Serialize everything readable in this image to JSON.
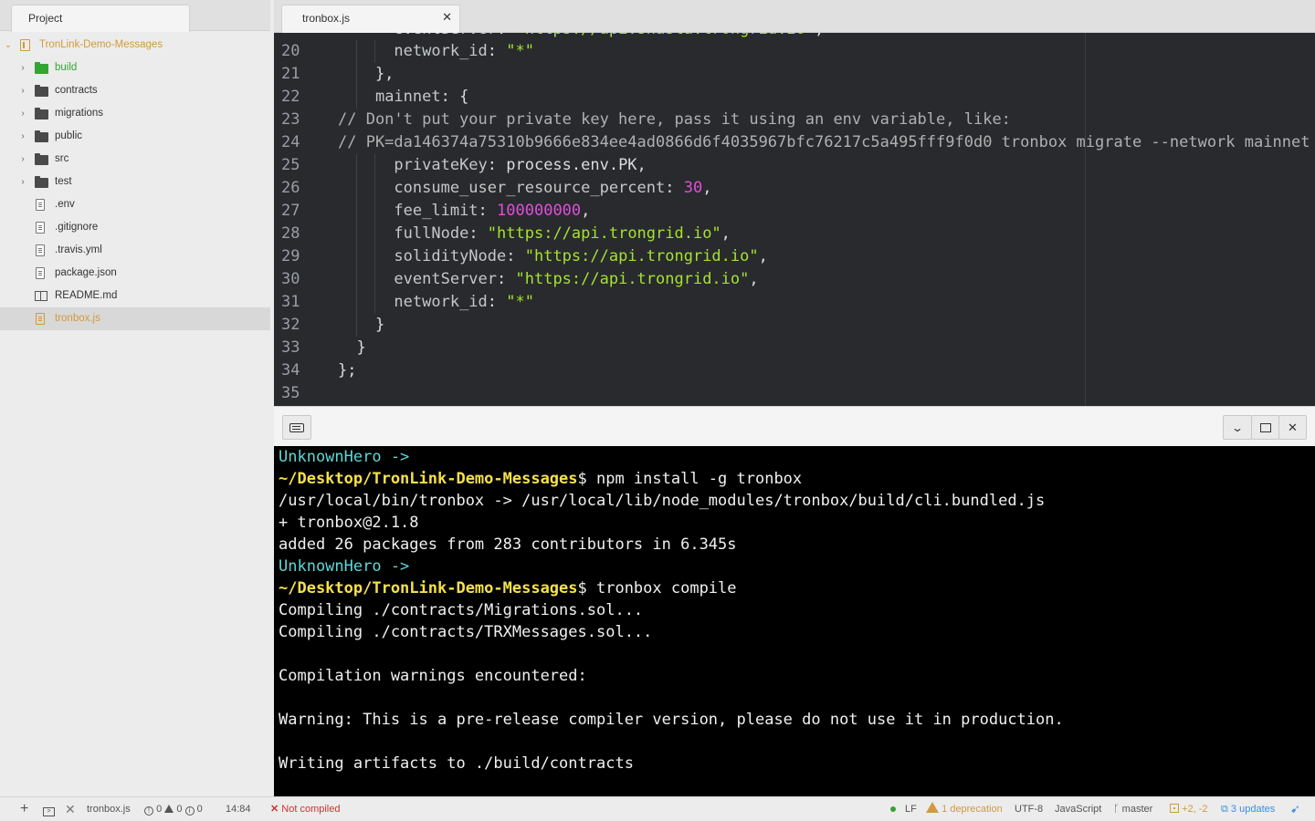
{
  "sidebar": {
    "tab_label": "Project",
    "project_name": "TronLink-Demo-Messages",
    "folders": [
      {
        "name": "build",
        "color": "green"
      },
      {
        "name": "contracts"
      },
      {
        "name": "migrations"
      },
      {
        "name": "public"
      },
      {
        "name": "src"
      },
      {
        "name": "test"
      }
    ],
    "files": [
      ".env",
      ".gitignore",
      ".travis.yml",
      "package.json",
      "README.md",
      "tronbox.js"
    ],
    "selected_file": "tronbox.js"
  },
  "editor": {
    "tab_label": "tronbox.js",
    "top_partial_line": "      eventServer: \"https://api.shasta.trongrid.io\",",
    "lines": [
      {
        "n": "20",
        "text": "      network_id: \"*\""
      },
      {
        "n": "21",
        "text": "    },"
      },
      {
        "n": "22",
        "text": "    mainnet: {"
      },
      {
        "n": "23",
        "text": "// Don't put your private key here, pass it using an env variable, like:"
      },
      {
        "n": "24",
        "text": "// PK=da146374a75310b9666e834ee4ad0866d6f4035967bfc76217c5a495fff9f0d0 tronbox migrate --network mainnet"
      },
      {
        "n": "25",
        "text": "      privateKey: process.env.PK,"
      },
      {
        "n": "26",
        "text": "      consume_user_resource_percent: 30,"
      },
      {
        "n": "27",
        "text": "      fee_limit: 100000000,"
      },
      {
        "n": "28",
        "text": "      fullNode: \"https://api.trongrid.io\","
      },
      {
        "n": "29",
        "text": "      solidityNode: \"https://api.trongrid.io\","
      },
      {
        "n": "30",
        "text": "      eventServer: \"https://api.trongrid.io\","
      },
      {
        "n": "31",
        "text": "      network_id: \"*\""
      },
      {
        "n": "32",
        "text": "    }"
      },
      {
        "n": "33",
        "text": "  }"
      },
      {
        "n": "34",
        "text": "};"
      },
      {
        "n": "35",
        "text": ""
      }
    ]
  },
  "terminal": {
    "lines": [
      {
        "type": "user",
        "text": "UnknownHero ->"
      },
      {
        "type": "prompt",
        "path": "~/Desktop/TronLink-Demo-Messages",
        "cmd": "$ npm install -g tronbox"
      },
      {
        "type": "out",
        "text": "/usr/local/bin/tronbox -> /usr/local/lib/node_modules/tronbox/build/cli.bundled.js"
      },
      {
        "type": "out",
        "text": "+ tronbox@2.1.8"
      },
      {
        "type": "out",
        "text": "added 26 packages from 283 contributors in 6.345s"
      },
      {
        "type": "user",
        "text": "UnknownHero ->"
      },
      {
        "type": "prompt",
        "path": "~/Desktop/TronLink-Demo-Messages",
        "cmd": "$ tronbox compile"
      },
      {
        "type": "out",
        "text": "Compiling ./contracts/Migrations.sol..."
      },
      {
        "type": "out",
        "text": "Compiling ./contracts/TRXMessages.sol..."
      },
      {
        "type": "out",
        "text": ""
      },
      {
        "type": "out",
        "text": "Compilation warnings encountered:"
      },
      {
        "type": "out",
        "text": ""
      },
      {
        "type": "out",
        "text": "Warning: This is a pre-release compiler version, please do not use it in production."
      },
      {
        "type": "out",
        "text": ""
      },
      {
        "type": "out",
        "text": "Writing artifacts to ./build/contracts"
      }
    ]
  },
  "statusbar": {
    "file": "tronbox.js",
    "errors": "0",
    "warnings": "0",
    "infos": "0",
    "cursor": "14:84",
    "compile_status": "Not compiled",
    "line_ending": "LF",
    "deprecations": "1 deprecation",
    "encoding": "UTF-8",
    "grammar": "JavaScript",
    "branch": "master",
    "git_diff": "+2, -2",
    "updates": "3 updates"
  },
  "colors": {
    "accent": "#d19a3a",
    "string": "#a6e22e",
    "number": "#e04fd8",
    "terminal_user": "#5fd7d7",
    "terminal_path": "#f5e14a",
    "error": "#d0312d",
    "link": "#3a8ee6"
  }
}
